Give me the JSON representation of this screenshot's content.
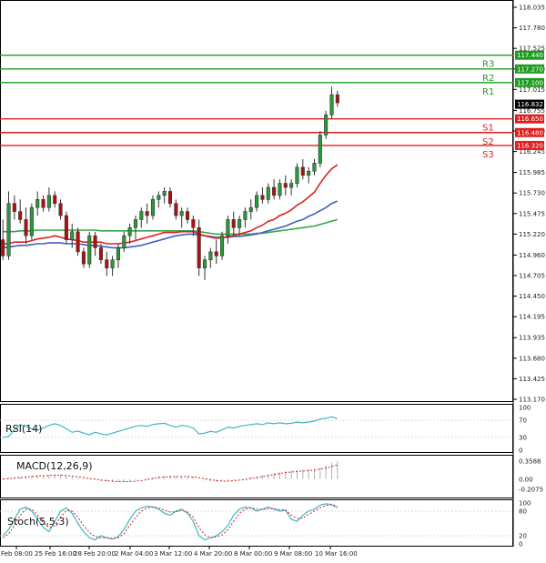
{
  "chart_data": {
    "type": "candlestick",
    "main_panel": {
      "ylim": [
        113.17,
        118.2
      ],
      "y_ticks": [
        "118.035",
        "117.780",
        "117.525",
        "117.270",
        "117.015",
        "116.755",
        "116.500",
        "116.245",
        "115.985",
        "115.730",
        "115.475",
        "115.220",
        "114.960",
        "114.705",
        "114.450",
        "114.195",
        "113.935",
        "113.680",
        "113.425",
        "113.170"
      ],
      "current_price": "116.832",
      "current_price_value": 116.832,
      "levels": [
        {
          "label": "R3",
          "value": 117.44,
          "badge": "117.440",
          "color": "#1f9b1f"
        },
        {
          "label": "R2",
          "value": 117.27,
          "badge": "117.270",
          "color": "#1f9b1f"
        },
        {
          "label": "R1",
          "value": 117.1,
          "badge": "117.100",
          "color": "#1f9b1f"
        },
        {
          "label": "S1",
          "value": 116.65,
          "badge": "116.650",
          "color": "#e01e1e"
        },
        {
          "label": "S2",
          "value": 116.48,
          "badge": "116.480",
          "color": "#e01e1e"
        },
        {
          "label": "S3",
          "value": 116.32,
          "badge": "116.320",
          "color": "#e01e1e"
        }
      ],
      "candles": [
        [
          115.15,
          115.4,
          114.9,
          114.95
        ],
        [
          114.95,
          115.75,
          114.9,
          115.6
        ],
        [
          115.6,
          115.7,
          115.4,
          115.5
        ],
        [
          115.5,
          115.65,
          115.35,
          115.4
        ],
        [
          115.4,
          115.55,
          115.1,
          115.2
        ],
        [
          115.2,
          115.6,
          115.15,
          115.55
        ],
        [
          115.55,
          115.75,
          115.45,
          115.65
        ],
        [
          115.65,
          115.7,
          115.5,
          115.55
        ],
        [
          115.55,
          115.8,
          115.5,
          115.7
        ],
        [
          115.7,
          115.75,
          115.55,
          115.6
        ],
        [
          115.6,
          115.65,
          115.4,
          115.45
        ],
        [
          115.45,
          115.5,
          115.1,
          115.15
        ],
        [
          115.15,
          115.35,
          115.05,
          115.25
        ],
        [
          115.25,
          115.3,
          114.95,
          115.0
        ],
        [
          115.0,
          115.05,
          114.8,
          114.85
        ],
        [
          114.85,
          115.25,
          114.8,
          115.2
        ],
        [
          115.2,
          115.25,
          114.95,
          115.05
        ],
        [
          115.05,
          115.1,
          114.85,
          114.9
        ],
        [
          114.9,
          115.0,
          114.7,
          114.8
        ],
        [
          114.8,
          114.95,
          114.7,
          114.9
        ],
        [
          114.9,
          115.1,
          114.8,
          115.05
        ],
        [
          115.05,
          115.25,
          115.0,
          115.2
        ],
        [
          115.2,
          115.35,
          115.1,
          115.3
        ],
        [
          115.3,
          115.45,
          115.15,
          115.4
        ],
        [
          115.4,
          115.55,
          115.3,
          115.5
        ],
        [
          115.5,
          115.6,
          115.35,
          115.45
        ],
        [
          115.45,
          115.7,
          115.4,
          115.65
        ],
        [
          115.65,
          115.75,
          115.55,
          115.7
        ],
        [
          115.7,
          115.8,
          115.6,
          115.75
        ],
        [
          115.75,
          115.8,
          115.55,
          115.6
        ],
        [
          115.6,
          115.65,
          115.4,
          115.45
        ],
        [
          115.45,
          115.55,
          115.3,
          115.5
        ],
        [
          115.5,
          115.55,
          115.35,
          115.4
        ],
        [
          115.4,
          115.45,
          115.2,
          115.3
        ],
        [
          115.3,
          115.4,
          114.7,
          114.8
        ],
        [
          114.8,
          114.95,
          114.65,
          114.9
        ],
        [
          114.9,
          115.05,
          114.8,
          115.0
        ],
        [
          115.0,
          115.15,
          114.85,
          114.95
        ],
        [
          114.95,
          115.25,
          114.9,
          115.2
        ],
        [
          115.2,
          115.45,
          115.1,
          115.4
        ],
        [
          115.4,
          115.5,
          115.2,
          115.3
        ],
        [
          115.3,
          115.45,
          115.2,
          115.4
        ],
        [
          115.4,
          115.55,
          115.3,
          115.5
        ],
        [
          115.5,
          115.65,
          115.4,
          115.55
        ],
        [
          115.55,
          115.75,
          115.5,
          115.7
        ],
        [
          115.7,
          115.8,
          115.6,
          115.65
        ],
        [
          115.65,
          115.85,
          115.6,
          115.8
        ],
        [
          115.8,
          115.9,
          115.65,
          115.7
        ],
        [
          115.7,
          115.9,
          115.65,
          115.85
        ],
        [
          115.85,
          115.95,
          115.7,
          115.8
        ],
        [
          115.8,
          115.9,
          115.7,
          115.85
        ],
        [
          115.85,
          116.1,
          115.8,
          116.05
        ],
        [
          116.05,
          116.15,
          115.9,
          115.95
        ],
        [
          115.95,
          116.05,
          115.85,
          116.0
        ],
        [
          116.0,
          116.15,
          115.95,
          116.1
        ],
        [
          116.1,
          116.5,
          116.05,
          116.45
        ],
        [
          116.45,
          116.75,
          116.4,
          116.7
        ],
        [
          116.7,
          117.05,
          116.65,
          116.95
        ],
        [
          116.95,
          117.0,
          116.8,
          116.85
        ]
      ],
      "ema_red": [
        115.1,
        115.1,
        115.12,
        115.12,
        115.12,
        115.14,
        115.16,
        115.17,
        115.18,
        115.2,
        115.18,
        115.16,
        115.15,
        115.14,
        115.12,
        115.12,
        115.12,
        115.12,
        115.1,
        115.1,
        115.1,
        115.11,
        115.12,
        115.14,
        115.16,
        115.18,
        115.2,
        115.22,
        115.24,
        115.24,
        115.24,
        115.25,
        115.25,
        115.25,
        115.22,
        115.2,
        115.18,
        115.17,
        115.17,
        115.19,
        115.2,
        115.22,
        115.24,
        115.26,
        115.3,
        115.33,
        115.38,
        115.4,
        115.45,
        115.48,
        115.52,
        115.58,
        115.62,
        115.68,
        115.74,
        115.85,
        115.95,
        116.03,
        116.08
      ],
      "sma_blue": [
        115.05,
        115.06,
        115.07,
        115.08,
        115.08,
        115.09,
        115.1,
        115.1,
        115.11,
        115.11,
        115.11,
        115.1,
        115.1,
        115.1,
        115.09,
        115.08,
        115.08,
        115.07,
        115.06,
        115.05,
        115.05,
        115.05,
        115.06,
        115.07,
        115.08,
        115.1,
        115.12,
        115.14,
        115.16,
        115.18,
        115.2,
        115.21,
        115.22,
        115.22,
        115.21,
        115.2,
        115.19,
        115.18,
        115.18,
        115.18,
        115.19,
        115.19,
        115.2,
        115.21,
        115.22,
        115.24,
        115.26,
        115.28,
        115.3,
        115.32,
        115.35,
        115.38,
        115.4,
        115.44,
        115.47,
        115.51,
        115.55,
        115.6,
        115.63
      ],
      "sma_green": [
        115.25,
        115.25,
        115.25,
        115.26,
        115.26,
        115.26,
        115.27,
        115.27,
        115.27,
        115.27,
        115.27,
        115.27,
        115.27,
        115.27,
        115.27,
        115.27,
        115.27,
        115.26,
        115.26,
        115.26,
        115.26,
        115.26,
        115.26,
        115.26,
        115.26,
        115.26,
        115.26,
        115.26,
        115.26,
        115.26,
        115.26,
        115.26,
        115.26,
        115.26,
        115.25,
        115.24,
        115.23,
        115.22,
        115.22,
        115.22,
        115.22,
        115.22,
        115.22,
        115.22,
        115.23,
        115.23,
        115.24,
        115.25,
        115.26,
        115.27,
        115.28,
        115.29,
        115.3,
        115.31,
        115.32,
        115.34,
        115.36,
        115.38,
        115.4
      ]
    },
    "rsi_panel": {
      "label": "RSI(14)",
      "ylim": [
        0,
        100
      ],
      "ticks": [
        "100",
        "70",
        "30",
        "0"
      ],
      "values": [
        30,
        32,
        48,
        60,
        55,
        50,
        47,
        52,
        58,
        62,
        58,
        50,
        42,
        45,
        40,
        36,
        42,
        38,
        36,
        40,
        44,
        48,
        52,
        56,
        58,
        56,
        60,
        62,
        63,
        58,
        54,
        58,
        56,
        52,
        38,
        40,
        44,
        42,
        48,
        54,
        52,
        56,
        58,
        60,
        62,
        60,
        64,
        62,
        64,
        62,
        63,
        66,
        64,
        66,
        68,
        73,
        75,
        78,
        74
      ]
    },
    "macd_panel": {
      "label": "MACD(12,26,9)",
      "ylim": [
        -0.35,
        0.45
      ],
      "ticks": [
        "0.3588",
        "0.00",
        "-0.2075"
      ],
      "hist": [
        0.02,
        0.03,
        0.04,
        0.05,
        0.06,
        0.07,
        0.08,
        0.08,
        0.09,
        0.1,
        0.09,
        0.07,
        0.05,
        0.03,
        0.01,
        -0.01,
        -0.02,
        -0.04,
        -0.05,
        -0.06,
        -0.06,
        -0.05,
        -0.04,
        -0.02,
        0.0,
        0.02,
        0.04,
        0.06,
        0.07,
        0.07,
        0.06,
        0.06,
        0.05,
        0.04,
        0.0,
        -0.03,
        -0.05,
        -0.06,
        -0.05,
        -0.03,
        -0.02,
        0.0,
        0.02,
        0.04,
        0.06,
        0.08,
        0.1,
        0.12,
        0.14,
        0.16,
        0.17,
        0.18,
        0.19,
        0.2,
        0.21,
        0.24,
        0.28,
        0.33,
        0.36
      ],
      "signal": [
        0.0,
        0.01,
        0.02,
        0.03,
        0.04,
        0.05,
        0.06,
        0.07,
        0.07,
        0.08,
        0.08,
        0.07,
        0.06,
        0.05,
        0.03,
        0.01,
        0.0,
        -0.02,
        -0.03,
        -0.04,
        -0.05,
        -0.05,
        -0.05,
        -0.04,
        -0.03,
        -0.01,
        0.01,
        0.03,
        0.04,
        0.05,
        0.05,
        0.05,
        0.05,
        0.04,
        0.03,
        0.01,
        -0.01,
        -0.03,
        -0.04,
        -0.04,
        -0.03,
        -0.02,
        -0.01,
        0.01,
        0.03,
        0.05,
        0.07,
        0.09,
        0.11,
        0.13,
        0.14,
        0.15,
        0.16,
        0.17,
        0.18,
        0.2,
        0.22,
        0.25,
        0.28
      ]
    },
    "stoch_panel": {
      "label": "Stoch(5,5,3)",
      "ylim": [
        0,
        100
      ],
      "ticks": [
        "100",
        "80",
        "20",
        "0"
      ],
      "k": [
        20,
        35,
        60,
        85,
        90,
        80,
        60,
        40,
        30,
        55,
        80,
        88,
        75,
        50,
        30,
        15,
        10,
        20,
        15,
        12,
        18,
        35,
        60,
        80,
        88,
        92,
        90,
        85,
        75,
        70,
        80,
        85,
        75,
        55,
        20,
        10,
        15,
        20,
        30,
        45,
        70,
        85,
        90,
        88,
        80,
        85,
        90,
        85,
        80,
        82,
        60,
        55,
        70,
        80,
        85,
        95,
        98,
        96,
        88
      ],
      "d": [
        15,
        25,
        45,
        70,
        85,
        85,
        70,
        52,
        40,
        45,
        65,
        82,
        80,
        65,
        45,
        28,
        18,
        15,
        15,
        13,
        15,
        25,
        45,
        65,
        80,
        88,
        90,
        88,
        82,
        78,
        78,
        82,
        78,
        65,
        40,
        22,
        15,
        17,
        22,
        35,
        55,
        75,
        85,
        88,
        85,
        84,
        86,
        86,
        84,
        83,
        70,
        62,
        63,
        72,
        80,
        88,
        94,
        96,
        92
      ]
    },
    "x_ticks": [
      "Feb 08:00",
      "25 Feb 16:00",
      "28 Feb 20:00",
      "2 Mar 04:00",
      "3 Mar 12:00",
      "4 Mar 20:00",
      "8 Mar 00:00",
      "9 Mar 08:00",
      "10 Mar 16:00"
    ]
  }
}
